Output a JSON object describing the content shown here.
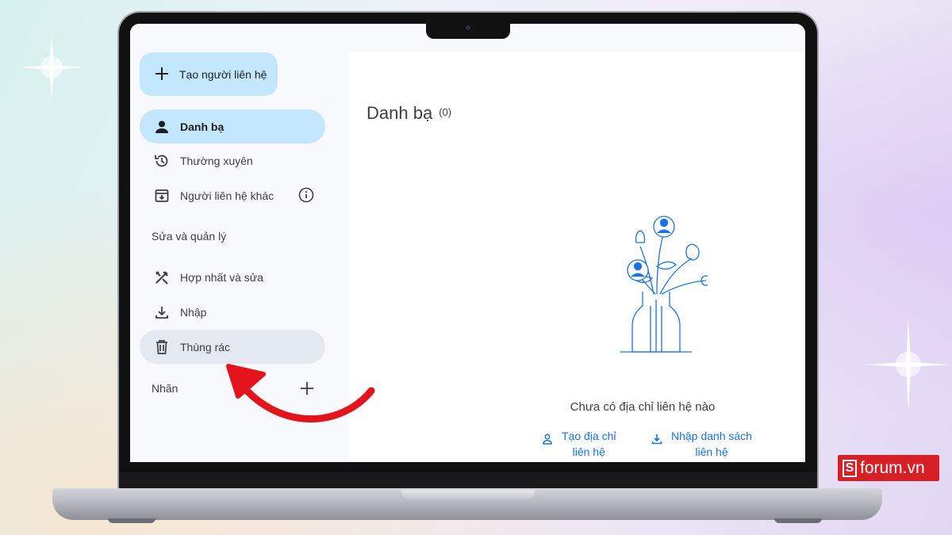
{
  "sidebar": {
    "create_label": "Tạo người liên hệ",
    "items": [
      {
        "label": "Danh bạ",
        "icon": "person-icon"
      },
      {
        "label": "Thường xuyên",
        "icon": "history-icon"
      },
      {
        "label": "Người liên hệ khác",
        "icon": "archive-download-icon"
      }
    ],
    "section_manage": "Sửa và quản lý",
    "manage_items": [
      {
        "label": "Hợp nhất và sửa",
        "icon": "tools-icon"
      },
      {
        "label": "Nhập",
        "icon": "download-icon"
      },
      {
        "label": "Thùng rác",
        "icon": "trash-icon"
      }
    ],
    "labels_heading": "Nhãn"
  },
  "main": {
    "title": "Danh bạ",
    "count": "(0)",
    "empty_message": "Chưa có địa chỉ liên hệ nào",
    "actions": [
      {
        "line1": "Tạo địa chỉ",
        "line2": "liên hệ",
        "icon": "person-outline-icon"
      },
      {
        "line1": "Nhập danh sách",
        "line2": "liên hệ",
        "icon": "download-icon"
      }
    ]
  },
  "watermark": {
    "text": "forum.vn",
    "letter": "S",
    "color": "#d71f26"
  },
  "colors": {
    "accent": "#1a73e8",
    "active_bg": "#c2e7ff",
    "arrow": "#e3141c"
  }
}
